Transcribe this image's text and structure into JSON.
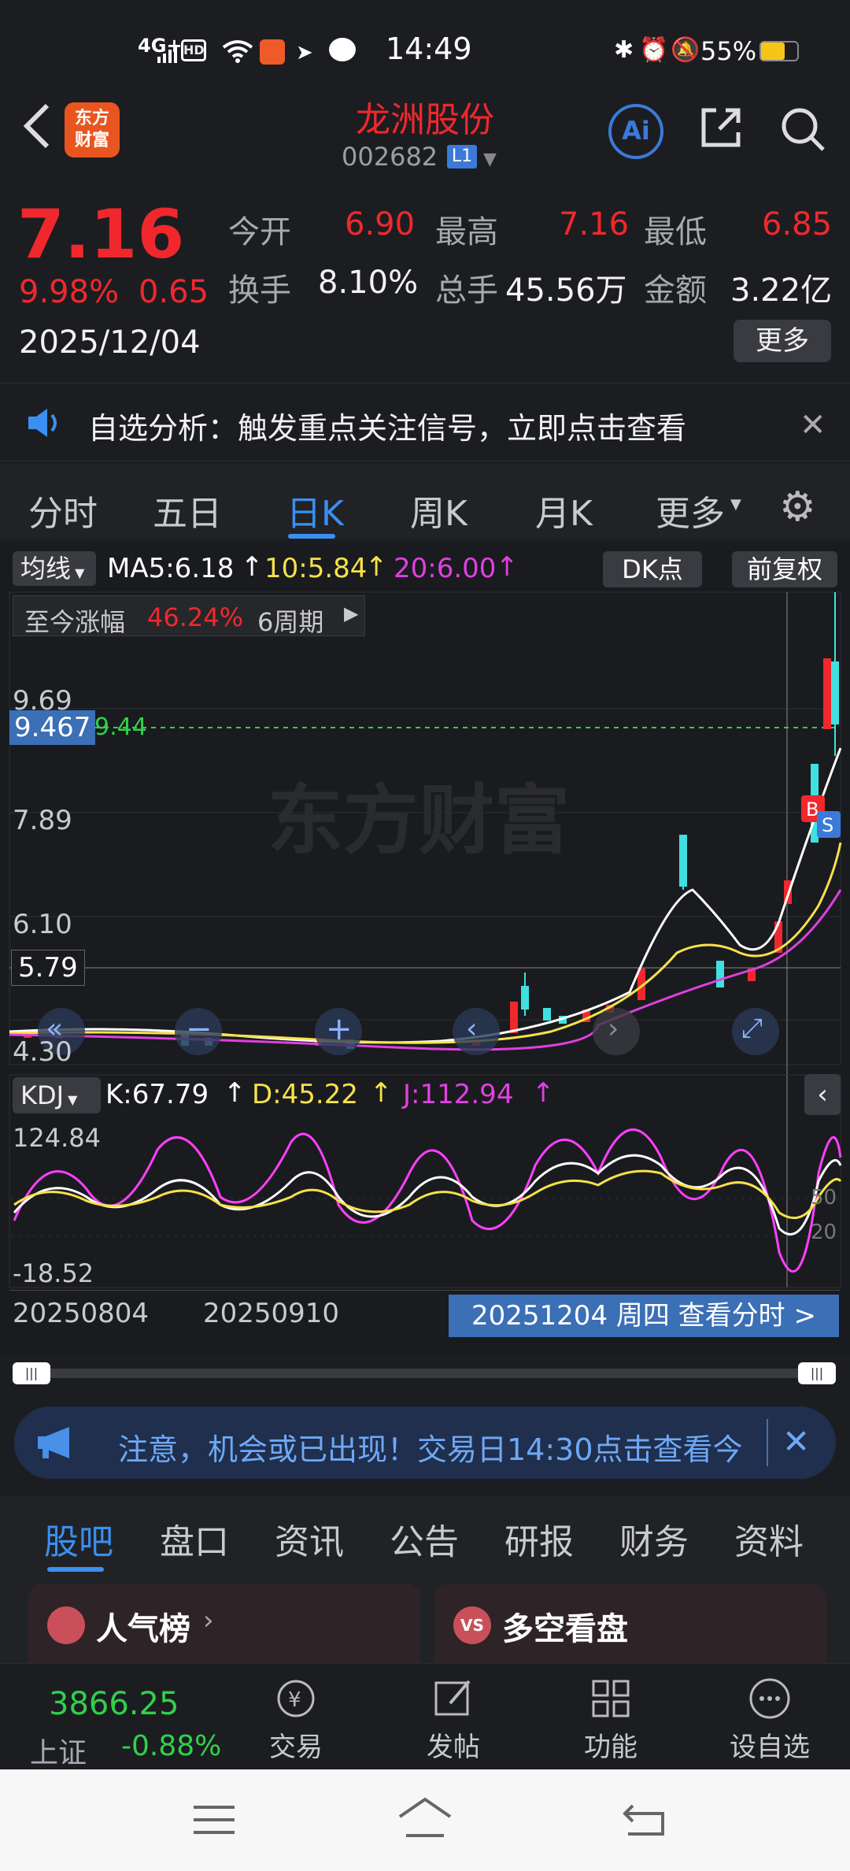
{
  "status_bar": {
    "time": "14:49",
    "battery": "55%",
    "network": "4G+"
  },
  "header": {
    "brand_line1": "东方",
    "brand_line2": "财富",
    "stock_name": "龙洲股份",
    "stock_code": "002682",
    "level_badge": "L1",
    "ai_label": "Ai"
  },
  "quote": {
    "price": "7.16",
    "change_pct": "9.98%",
    "change": "0.65",
    "date": "2025/12/04",
    "open_label": "今开",
    "open": "6.90",
    "high_label": "最高",
    "high": "7.16",
    "low_label": "最低",
    "low": "6.85",
    "turnover_label": "换手",
    "turnover": "8.10%",
    "volume_label": "总手",
    "volume": "45.56万",
    "amount_label": "金额",
    "amount": "3.22亿",
    "more_label": "更多"
  },
  "notice1": {
    "text": "自选分析：触发重点关注信号，立即点击查看"
  },
  "period_tabs": [
    "分时",
    "五日",
    "日K",
    "周K",
    "月K",
    "更多"
  ],
  "period_active": 2,
  "chart_toolbar": {
    "indicator_btn": "均线",
    "ma5_label": "MA5:6.18",
    "ma10_label": "10:5.84",
    "ma20_label": "20:6.00",
    "dk_label": "DK点",
    "adjust_label": "前复权",
    "since_label": "至今涨幅",
    "since_value": "46.24%",
    "period_label": "6周期"
  },
  "chart_data": {
    "type": "candlestick",
    "y_ticks": [
      "9.69",
      "7.89",
      "6.10",
      "4.30"
    ],
    "crosshair_price": "9.467",
    "ref_price": "9.44",
    "cursor_price": "5.79",
    "watermark": "东方财富",
    "kdj_label": "KDJ",
    "k_label": "K:67.79",
    "d_label": "D:45.22",
    "j_label": "J:112.94",
    "kdj_ticks": [
      "124.84",
      "-18.52"
    ],
    "kdj_right_ticks": [
      "50",
      "20"
    ],
    "x_ticks": [
      "20250804",
      "20250910"
    ],
    "selected_date": "20251204 周四 查看分时 >"
  },
  "notice2": {
    "text": "注意，机会或已出现！交易日14:30点击查看今"
  },
  "info_tabs": [
    "股吧",
    "盘口",
    "资讯",
    "公告",
    "研报",
    "财务",
    "资料"
  ],
  "info_active": 0,
  "cards": [
    {
      "label": "人气榜"
    },
    {
      "label": "多空看盘"
    }
  ],
  "bottom_nav": {
    "index_value": "3866.25",
    "index_name": "上证",
    "index_change": "-0.88%",
    "items": [
      "交易",
      "发帖",
      "功能",
      "设自选"
    ]
  },
  "colors": {
    "up": "#f0282d",
    "down": "#2fd24a",
    "ma5": "#ffffff",
    "ma10": "#f5e24a",
    "ma20": "#e040e0",
    "accent": "#3b8ff0"
  }
}
